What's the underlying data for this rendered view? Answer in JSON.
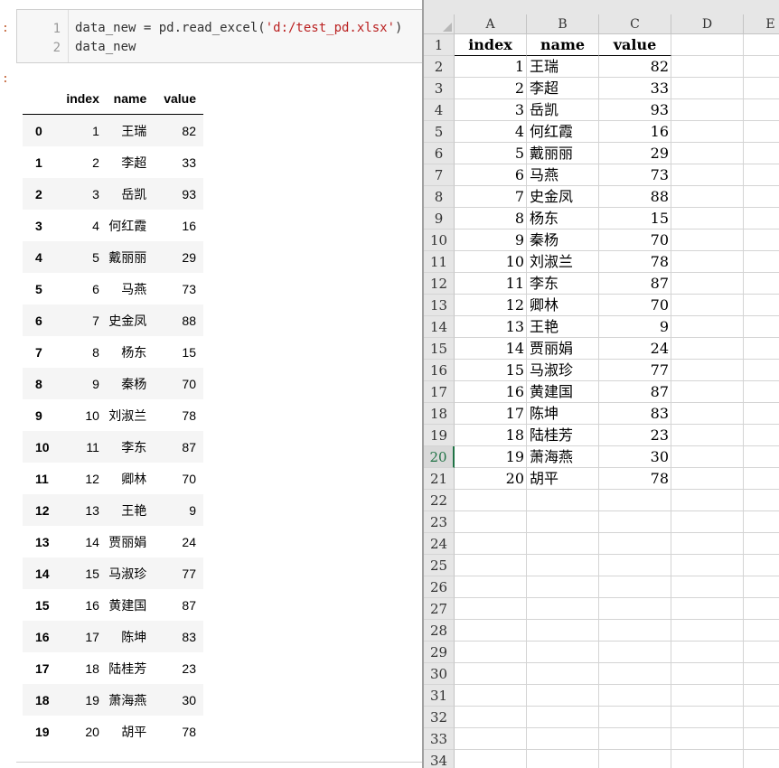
{
  "notebook": {
    "in_prompt": ":",
    "out_prompt": ":",
    "line_numbers": [
      "1",
      "2"
    ],
    "code_line1_pre": "data_new = pd.read_excel(",
    "code_line1_str": "'d:/test_pd.xlsx'",
    "code_line1_post": ")",
    "code_line2": "data_new",
    "df_columns": [
      "",
      "index",
      "name",
      "value"
    ],
    "df_rows": [
      {
        "i": "0",
        "index": "1",
        "name": "王瑞",
        "value": "82"
      },
      {
        "i": "1",
        "index": "2",
        "name": "李超",
        "value": "33"
      },
      {
        "i": "2",
        "index": "3",
        "name": "岳凯",
        "value": "93"
      },
      {
        "i": "3",
        "index": "4",
        "name": "何红霞",
        "value": "16"
      },
      {
        "i": "4",
        "index": "5",
        "name": "戴丽丽",
        "value": "29"
      },
      {
        "i": "5",
        "index": "6",
        "name": "马燕",
        "value": "73"
      },
      {
        "i": "6",
        "index": "7",
        "name": "史金凤",
        "value": "88"
      },
      {
        "i": "7",
        "index": "8",
        "name": "杨东",
        "value": "15"
      },
      {
        "i": "8",
        "index": "9",
        "name": "秦杨",
        "value": "70"
      },
      {
        "i": "9",
        "index": "10",
        "name": "刘淑兰",
        "value": "78"
      },
      {
        "i": "10",
        "index": "11",
        "name": "李东",
        "value": "87"
      },
      {
        "i": "11",
        "index": "12",
        "name": "卿林",
        "value": "70"
      },
      {
        "i": "12",
        "index": "13",
        "name": "王艳",
        "value": "9"
      },
      {
        "i": "13",
        "index": "14",
        "name": "贾丽娟",
        "value": "24"
      },
      {
        "i": "14",
        "index": "15",
        "name": "马淑珍",
        "value": "77"
      },
      {
        "i": "15",
        "index": "16",
        "name": "黄建国",
        "value": "87"
      },
      {
        "i": "16",
        "index": "17",
        "name": "陈坤",
        "value": "83"
      },
      {
        "i": "17",
        "index": "18",
        "name": "陆桂芳",
        "value": "23"
      },
      {
        "i": "18",
        "index": "19",
        "name": "萧海燕",
        "value": "30"
      },
      {
        "i": "19",
        "index": "20",
        "name": "胡平",
        "value": "78"
      }
    ]
  },
  "excel": {
    "column_letters": [
      "A",
      "B",
      "C",
      "D",
      "E"
    ],
    "header_row": [
      "index",
      "name",
      "value"
    ],
    "selected_row": "20",
    "accent_color": "#217346",
    "row_numbers": [
      "1",
      "2",
      "3",
      "4",
      "5",
      "6",
      "7",
      "8",
      "9",
      "10",
      "11",
      "12",
      "13",
      "14",
      "15",
      "16",
      "17",
      "18",
      "19",
      "20",
      "21",
      "22",
      "23",
      "24",
      "25",
      "26",
      "27",
      "28",
      "29",
      "30",
      "31",
      "32",
      "33",
      "34"
    ]
  }
}
